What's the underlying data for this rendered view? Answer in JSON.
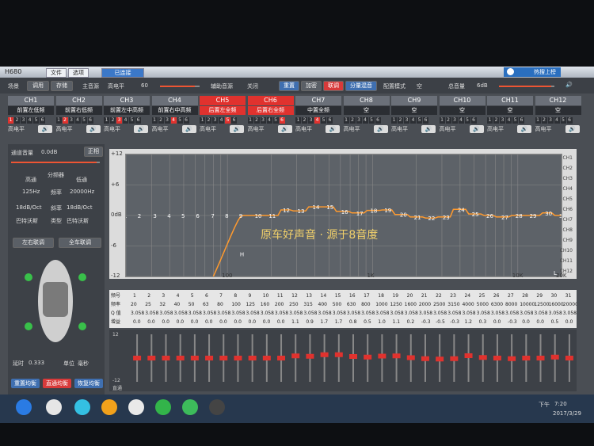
{
  "window": {
    "title": "H680",
    "menu": [
      "文件",
      "选项"
    ],
    "status": "已连接",
    "link_button": "热搜上榜"
  },
  "toolbar": {
    "scene_label": "场景",
    "call_button": "调用",
    "save_button": "存储",
    "main_vol_label": "主音源",
    "main_vol_value": "高电平",
    "main_vol_num": "60",
    "aux_label": "辅助音源",
    "aux_value": "关闭",
    "reset_button": "重置",
    "add_button": "加密",
    "link_button": "联调",
    "split_button": "分量混音",
    "mode_label": "配置模式",
    "mode_value": "空",
    "master_label": "总音量",
    "master_value": "6dB"
  },
  "channels": [
    {
      "name": "CH1",
      "mode": "前置左低频",
      "level": "高电平",
      "active": 1
    },
    {
      "name": "CH2",
      "mode": "前置右低频",
      "level": "高电平",
      "active": 2
    },
    {
      "name": "CH3",
      "mode": "前置左中高频",
      "level": "高电平",
      "active": 3
    },
    {
      "name": "CH4",
      "mode": "前置右中高频",
      "level": "高电平",
      "active": 4
    },
    {
      "name": "CH5",
      "mode": "后置左全频",
      "level": "高电平",
      "active": 5
    },
    {
      "name": "CH6",
      "mode": "后置右全频",
      "level": "高电平",
      "active": 6
    },
    {
      "name": "CH7",
      "mode": "中置全频",
      "level": "高电平",
      "active": 4
    },
    {
      "name": "CH8",
      "mode": "空",
      "level": "高电平",
      "active": 0
    },
    {
      "name": "CH9",
      "mode": "空",
      "level": "高电平",
      "active": 0
    },
    {
      "name": "CH10",
      "mode": "空",
      "level": "高电平",
      "active": 0
    },
    {
      "name": "CH11",
      "mode": "空",
      "level": "高电平",
      "active": 0
    },
    {
      "name": "CH12",
      "mode": "空",
      "level": "高电平",
      "active": 0
    }
  ],
  "left_panel": {
    "channel_vol_label": "通道音量",
    "channel_vol_value": "0.0dB",
    "phase_button": "正相",
    "hp_label": "高通",
    "divider_label": "分频器",
    "lp_label": "低通",
    "hp_freq": "125Hz",
    "freq_label": "频率",
    "lp_freq": "20000Hz",
    "hp_slope": "18dB/Oct",
    "slope_label": "斜率",
    "lp_slope": "18dB/Oct",
    "hp_type": "巴特沃斯",
    "type_label": "类型",
    "lp_type": "巴特沃斯",
    "lr_link": "左右联调",
    "all_link": "全车联调",
    "delay_label": "延时",
    "delay_value": "0.333",
    "unit_label": "单位",
    "unit_value": "毫秒",
    "reset_eq": "重置均衡",
    "pass_eq": "直通均衡",
    "save_eq": "恢复均衡"
  },
  "graph": {
    "y_ticks": [
      "+12",
      "+6",
      "0dB",
      "-6",
      "-12"
    ],
    "x_ticks": [
      "100",
      "1K",
      "10K",
      "20K"
    ],
    "watermark": "原车好声音 · 源于8音度",
    "channel_list": [
      "CH1",
      "CH2",
      "CH3",
      "CH4",
      "CH5",
      "CH6",
      "CH7",
      "CH8",
      "CH9",
      "CH10",
      "CH11",
      "CH12"
    ],
    "marker_h": "H",
    "marker_l": "L"
  },
  "eq_table": {
    "headers": [
      "频号",
      "频率",
      "Q 值",
      "增益"
    ],
    "bands": [
      "1",
      "2",
      "3",
      "4",
      "5",
      "6",
      "7",
      "8",
      "9",
      "10",
      "11",
      "12",
      "13",
      "14",
      "15",
      "16",
      "17",
      "18",
      "19",
      "20",
      "21",
      "22",
      "23",
      "24",
      "25",
      "26",
      "27",
      "28",
      "29",
      "30",
      "31"
    ],
    "freqs": [
      "20",
      "25",
      "32",
      "40",
      "50",
      "63",
      "80",
      "100",
      "125",
      "160",
      "200",
      "250",
      "315",
      "400",
      "500",
      "630",
      "800",
      "1000",
      "1250",
      "1600",
      "2000",
      "2500",
      "3150",
      "4000",
      "5000",
      "6300",
      "8000",
      "10000",
      "12500",
      "16000",
      "20000"
    ],
    "q": [
      "3.058",
      "3.058",
      "3.058",
      "3.058",
      "3.058",
      "3.058",
      "3.058",
      "3.058",
      "3.058",
      "3.058",
      "3.058",
      "3.058",
      "3.058",
      "3.058",
      "3.058",
      "3.058",
      "3.058",
      "3.058",
      "3.058",
      "3.058",
      "3.058",
      "3.058",
      "3.058",
      "3.058",
      "3.058",
      "3.058",
      "3.058",
      "3.058",
      "3.058",
      "3.058",
      "3.058"
    ],
    "gain": [
      "0.0",
      "0.0",
      "0.0",
      "0.0",
      "0.0",
      "0.0",
      "0.0",
      "0.0",
      "0.0",
      "0.0",
      "0.0",
      "1.1",
      "0.9",
      "1.7",
      "1.7",
      "0.8",
      "0.5",
      "1.0",
      "1.1",
      "0.2",
      "-0.3",
      "-0.5",
      "-0.3",
      "1.2",
      "0.3",
      "0.0",
      "-0.3",
      "0.0",
      "0.0",
      "0.5",
      "0.0"
    ]
  },
  "faders": {
    "top_label": "12",
    "bottom_label": "-12",
    "bypass_label": "直通"
  },
  "chart_data": {
    "type": "line",
    "x": [
      20,
      25,
      32,
      40,
      50,
      63,
      80,
      100,
      125,
      160,
      200,
      250,
      315,
      400,
      500,
      630,
      800,
      1000,
      1250,
      1600,
      2000,
      2500,
      3150,
      4000,
      5000,
      6300,
      8000,
      10000,
      12500,
      16000,
      20000
    ],
    "values": [
      0,
      0,
      0,
      0,
      0,
      0,
      0,
      0,
      0,
      0,
      0,
      1.1,
      0.9,
      1.7,
      1.7,
      0.8,
      0.5,
      1.0,
      1.1,
      0.2,
      -0.3,
      -0.5,
      -0.3,
      1.2,
      0.3,
      0,
      -0.3,
      0,
      0,
      0.5,
      0
    ],
    "ylim": [
      -12,
      12
    ],
    "xlim": [
      20,
      20000
    ],
    "xscale": "log",
    "colors": {
      "curve": "#ff9a2e",
      "points": "#ffffff"
    }
  },
  "taskbar": {
    "time": "7:20",
    "date": "2017/3/29",
    "prefix": "下午"
  }
}
